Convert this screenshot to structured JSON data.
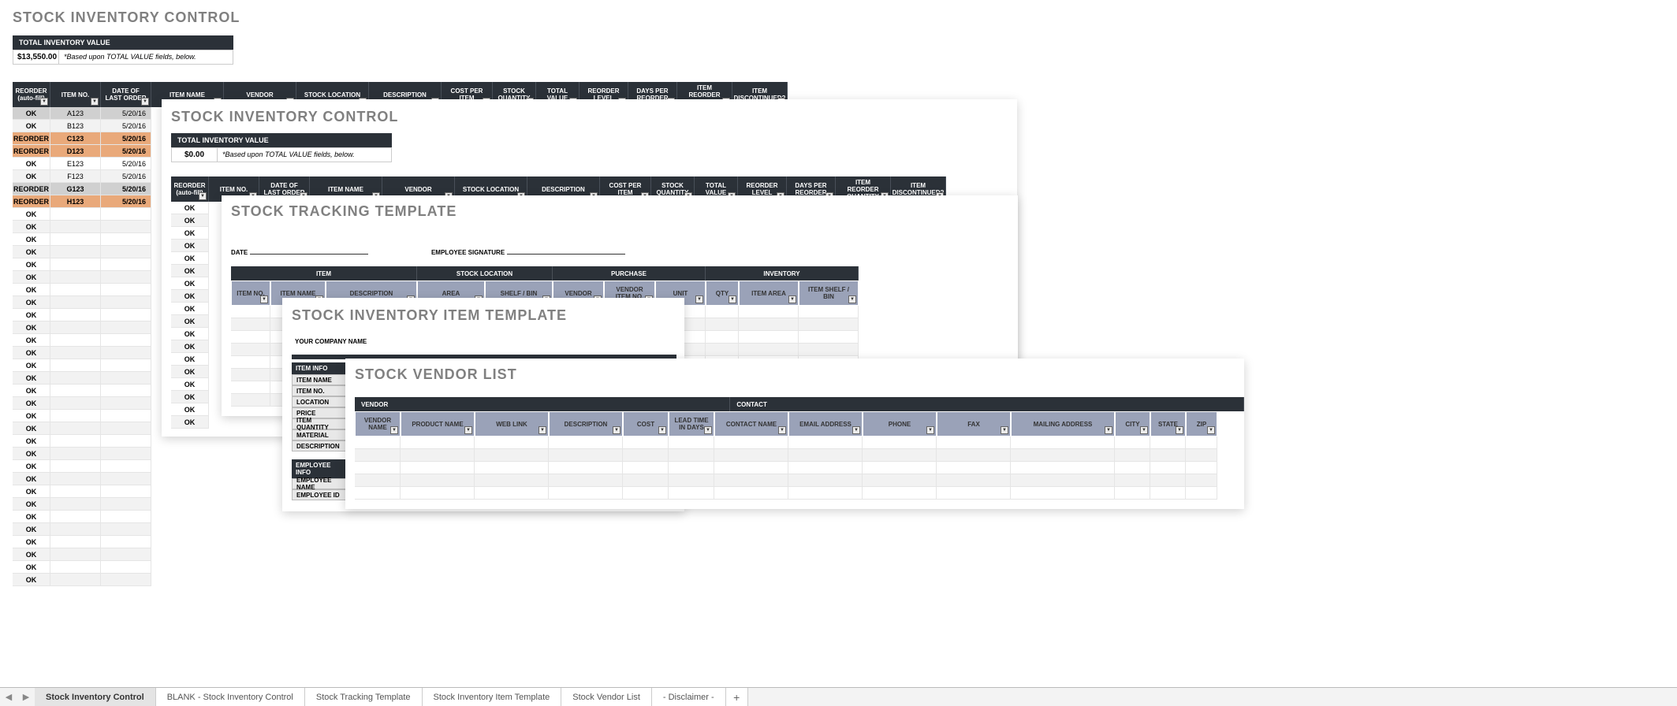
{
  "layer1": {
    "title": "STOCK INVENTORY CONTROL",
    "tiv_label": "TOTAL INVENTORY VALUE",
    "tiv_value": "$13,550.00",
    "tiv_note": "*Based upon TOTAL VALUE fields, below.",
    "cols": [
      "REORDER (auto-fill)",
      "ITEM NO.",
      "DATE OF LAST ORDER",
      "ITEM NAME",
      "VENDOR",
      "STOCK LOCATION",
      "DESCRIPTION",
      "COST PER ITEM",
      "STOCK QUANTITY",
      "TOTAL VALUE",
      "REORDER LEVEL",
      "DAYS PER REORDER",
      "ITEM REORDER QUANTITY",
      "ITEM DISCONTINUED?"
    ],
    "widths": [
      48,
      64,
      64,
      92,
      92,
      92,
      92,
      65,
      55,
      55,
      62,
      62,
      70,
      70
    ],
    "rows": [
      {
        "status": "OK",
        "item": "A123",
        "date": "5/20/16",
        "shade": true
      },
      {
        "status": "OK",
        "item": "B123",
        "date": "5/20/16"
      },
      {
        "status": "REORDER",
        "item": "C123",
        "date": "5/20/16"
      },
      {
        "status": "REORDER",
        "item": "D123",
        "date": "5/20/16"
      },
      {
        "status": "OK",
        "item": "E123",
        "date": "5/20/16"
      },
      {
        "status": "OK",
        "item": "F123",
        "date": "5/20/16"
      },
      {
        "status": "REORDER",
        "item": "G123",
        "date": "5/20/16",
        "shade": true
      },
      {
        "status": "REORDER",
        "item": "H123",
        "date": "5/20/16"
      }
    ],
    "ok_fill": 30,
    "ok_label": "OK"
  },
  "layer2": {
    "title": "STOCK INVENTORY CONTROL",
    "tiv_label": "TOTAL INVENTORY VALUE",
    "tiv_value": "$0.00",
    "tiv_note": "*Based upon TOTAL VALUE fields, below.",
    "cols": [
      "REORDER (auto-fill)",
      "ITEM NO.",
      "DATE OF LAST ORDER",
      "ITEM NAME",
      "VENDOR",
      "STOCK LOCATION",
      "DESCRIPTION",
      "COST PER ITEM",
      "STOCK QUANTITY",
      "TOTAL VALUE",
      "REORDER LEVEL",
      "DAYS PER REORDER",
      "ITEM REORDER QUANTITY",
      "ITEM DISCONTINUED?"
    ],
    "widths": [
      48,
      64,
      64,
      92,
      92,
      92,
      92,
      65,
      55,
      55,
      62,
      62,
      70,
      70
    ],
    "ok_fill": 18,
    "ok_label": "OK"
  },
  "layer3": {
    "title": "STOCK TRACKING TEMPLATE",
    "date_label": "DATE",
    "sig_label": "EMPLOYEE SIGNATURE",
    "groups": [
      "ITEM",
      "STOCK LOCATION",
      "PURCHASE",
      "INVENTORY"
    ],
    "group_widths": [
      236,
      172,
      194,
      194
    ],
    "subcols": [
      "ITEM NO.",
      "ITEM NAME",
      "DESCRIPTION",
      "AREA",
      "SHELF / BIN",
      "VENDOR",
      "VENDOR ITEM NO.",
      "UNIT",
      "QTY",
      "ITEM AREA",
      "ITEM SHELF / BIN"
    ],
    "sub_widths": [
      50,
      70,
      116,
      86,
      86,
      65,
      65,
      64,
      42,
      76,
      76
    ],
    "rows": 8
  },
  "layer4": {
    "title": "STOCK INVENTORY ITEM TEMPLATE",
    "company_label": "YOUR COMPANY NAME",
    "item_info_label": "ITEM INFO",
    "item_fields": [
      "ITEM NAME",
      "ITEM NO.",
      "LOCATION",
      "PRICE",
      "ITEM QUANTITY",
      "MATERIAL",
      "DESCRIPTION"
    ],
    "emp_info_label": "EMPLOYEE INFO",
    "emp_fields": [
      "EMPLOYEE NAME",
      "EMPLOYEE ID"
    ]
  },
  "layer5": {
    "title": "STOCK VENDOR LIST",
    "groups": [
      "VENDOR",
      "CONTACT"
    ],
    "group_widths": [
      478,
      654
    ],
    "subcols": [
      "VENDOR NAME",
      "PRODUCT NAME",
      "WEB LINK",
      "DESCRIPTION",
      "COST",
      "LEAD TIME IN DAYS",
      "CONTACT NAME",
      "EMAIL ADDRESS",
      "PHONE",
      "FAX",
      "MAILING ADDRESS",
      "CITY",
      "STATE",
      "ZIP"
    ],
    "sub_widths": [
      58,
      94,
      94,
      94,
      58,
      58,
      94,
      94,
      94,
      94,
      132,
      45,
      45,
      40
    ],
    "rows": 5
  },
  "tabs": {
    "items": [
      "Stock Inventory Control",
      "BLANK - Stock Inventory Control",
      "Stock Tracking Template",
      "Stock Inventory Item Template",
      "Stock Vendor List",
      "- Disclaimer -"
    ],
    "active": 0,
    "add": "+",
    "prev": "◀",
    "next": "▶"
  },
  "filter_glyph": "▼"
}
